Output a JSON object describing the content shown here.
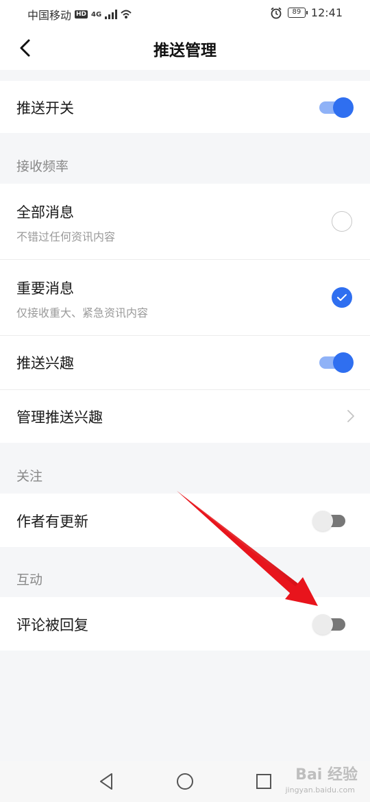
{
  "status_bar": {
    "carrier": "中国移动",
    "hd": "HD",
    "network": "4G",
    "battery": "89",
    "time": "12:41"
  },
  "header": {
    "title": "推送管理",
    "back_icon": "chevron-left-icon"
  },
  "push_switch": {
    "label": "推送开关",
    "on": true
  },
  "sections": {
    "frequency": "接收频率",
    "follow": "关注",
    "interaction": "互动"
  },
  "frequency_options": [
    {
      "title": "全部消息",
      "subtitle": "不错过任何资讯内容",
      "selected": false
    },
    {
      "title": "重要消息",
      "subtitle": "仅接收重大、紧急资讯内容",
      "selected": true
    }
  ],
  "push_interest": {
    "label": "推送兴趣",
    "on": true
  },
  "manage_interest": {
    "label": "管理推送兴趣",
    "icon": "chevron-right-icon"
  },
  "author_update": {
    "label": "作者有更新",
    "on": false
  },
  "comment_reply": {
    "label": "评论被回复",
    "on": false
  },
  "annotation": {
    "color": "#e8141c",
    "icon": "red-arrow"
  },
  "colors": {
    "accent": "#2f6ff0",
    "accent_light": "#8fb2f7"
  },
  "watermark": {
    "text": "Bai 经验",
    "sub": "jingyan.baidu.com"
  }
}
